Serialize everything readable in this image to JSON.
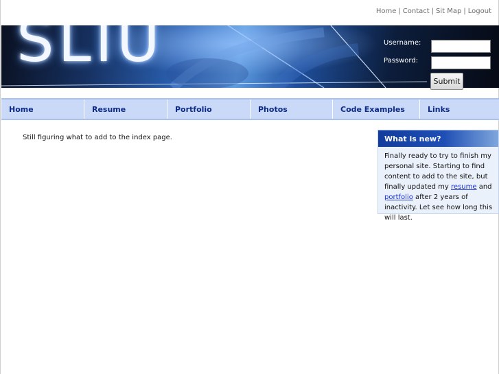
{
  "top_links": {
    "items": [
      "Home",
      "Contact",
      "Sit Map",
      "Logout"
    ],
    "separator": "|"
  },
  "banner": {
    "logo_text": "SLIU"
  },
  "login": {
    "username_label": "Username:",
    "password_label": "Password:",
    "username_value": "",
    "password_value": "",
    "submit_label": "Submit"
  },
  "nav": {
    "items": [
      "Home",
      "Resume",
      "Portfolio",
      "Photos",
      "Code Examples",
      "Links"
    ]
  },
  "main": {
    "intro_text": "Still figuring what to add to the index page."
  },
  "news": {
    "title": "What is new?",
    "text_1": "Finally ready to try to finish my personal site. Starting to find content to add to the site, but finally updated my",
    "link_resume": "resume",
    "text_and": "and",
    "link_portfolio": "portfolio",
    "text_2": "after 2 years of inactivity. Let see how long this will last."
  },
  "colors": {
    "nav_bg": "#c9d9f7",
    "nav_text": "#0d2a8a",
    "news_header": "#123c9d",
    "link": "#1a2fd8"
  }
}
